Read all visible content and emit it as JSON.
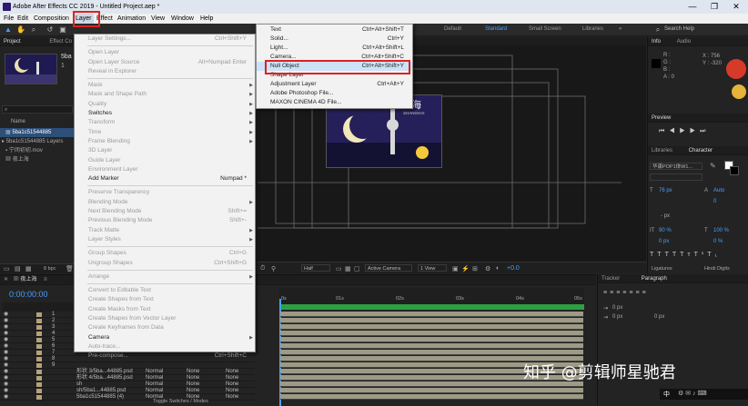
{
  "window": {
    "title": "Adobe After Effects CC 2019 - Untitled Project.aep *",
    "minimize": "—",
    "restore": "❐",
    "close": "✕"
  },
  "menubar": {
    "items": [
      "File",
      "Edit",
      "Composition",
      "Layer",
      "Effect",
      "Animation",
      "View",
      "Window",
      "Help"
    ]
  },
  "toolbar": {
    "workspaces": [
      "Default",
      "Standard",
      "Small Screen",
      "Libraries"
    ],
    "search_placeholder": "Search Help"
  },
  "project": {
    "tab": "Project",
    "effect_tab": "Effect Co",
    "item_name": "5ba",
    "item_detail": "1",
    "name_header": "Name",
    "items": [
      "5ba1c51544885",
      "5ba1c51544885 Layers",
      "宁闭初初.mov",
      "夜上海"
    ],
    "bpc": "8 bpc"
  },
  "layer_menu": {
    "items": [
      {
        "label": "Layer Settings...",
        "shortcut": "Ctrl+Shift+Y",
        "disabled": true
      },
      {
        "sep": true
      },
      {
        "label": "Open Layer",
        "disabled": true
      },
      {
        "label": "Open Layer Source",
        "shortcut": "Alt+Numpad Enter",
        "disabled": true
      },
      {
        "label": "Reveal in Explorer",
        "disabled": true
      },
      {
        "sep": true
      },
      {
        "label": "Mask",
        "arrow": true,
        "disabled": true
      },
      {
        "label": "Mask and Shape Path",
        "arrow": true,
        "disabled": true
      },
      {
        "label": "Quality",
        "arrow": true,
        "disabled": true
      },
      {
        "label": "Switches",
        "arrow": true
      },
      {
        "label": "Transform",
        "arrow": true,
        "disabled": true
      },
      {
        "label": "Time",
        "arrow": true,
        "disabled": true
      },
      {
        "label": "Frame Blending",
        "arrow": true,
        "disabled": true
      },
      {
        "label": "3D Layer",
        "disabled": true
      },
      {
        "label": "Guide Layer",
        "disabled": true
      },
      {
        "label": "Environment Layer",
        "disabled": true
      },
      {
        "label": "Add Marker",
        "shortcut": "Numpad *"
      },
      {
        "sep": true
      },
      {
        "label": "Preserve Transparency",
        "disabled": true
      },
      {
        "label": "Blending Mode",
        "arrow": true,
        "disabled": true
      },
      {
        "label": "Next Blending Mode",
        "shortcut": "Shift+=",
        "disabled": true
      },
      {
        "label": "Previous Blending Mode",
        "shortcut": "Shift+-",
        "disabled": true
      },
      {
        "label": "Track Matte",
        "arrow": true,
        "disabled": true
      },
      {
        "label": "Layer Styles",
        "arrow": true,
        "disabled": true
      },
      {
        "sep": true
      },
      {
        "label": "Group Shapes",
        "shortcut": "Ctrl+G",
        "disabled": true
      },
      {
        "label": "Ungroup Shapes",
        "shortcut": "Ctrl+Shift+G",
        "disabled": true
      },
      {
        "sep": true
      },
      {
        "label": "Arrange",
        "arrow": true,
        "disabled": true
      },
      {
        "sep": true
      },
      {
        "label": "Convert to Editable Text",
        "disabled": true
      },
      {
        "label": "Create Shapes from Text",
        "disabled": true
      },
      {
        "label": "Create Masks from Text",
        "disabled": true
      },
      {
        "label": "Create Shapes from Vector Layer",
        "disabled": true
      },
      {
        "label": "Create Keyframes from Data",
        "disabled": true
      },
      {
        "label": "Camera",
        "arrow": true
      },
      {
        "label": "Auto-trace...",
        "disabled": true
      },
      {
        "label": "Pre-compose...",
        "shortcut": "Ctrl+Shift+C",
        "disabled": true
      }
    ]
  },
  "new_submenu": {
    "items": [
      {
        "label": "Text",
        "shortcut": "Ctrl+Alt+Shift+T"
      },
      {
        "label": "Solid...",
        "shortcut": "Ctrl+Y"
      },
      {
        "label": "Light...",
        "shortcut": "Ctrl+Alt+Shift+L"
      },
      {
        "label": "Camera...",
        "shortcut": "Ctrl+Alt+Shift+C"
      },
      {
        "label": "Null Object",
        "shortcut": "Ctrl+Alt+Shift+Y"
      },
      {
        "label": "Shape Layer"
      },
      {
        "label": "Adjustment Layer",
        "shortcut": "Ctrl+Alt+Y"
      },
      {
        "label": "Adobe Photoshop File..."
      },
      {
        "label": "MAXON CINEMA 4D File..."
      }
    ]
  },
  "viewer": {
    "art_title": "上海",
    "art_subtitle": "SHANGHAI",
    "zoom": "Half",
    "camera": "Active Camera",
    "view": "1 View",
    "exposure": "+0.0"
  },
  "info": {
    "tab": "Info",
    "audio_tab": "Audio",
    "r": "R :",
    "g": "G :",
    "b": "B :",
    "a": "A : 0",
    "x": "X : 756",
    "y": "Y : -320"
  },
  "preview": {
    "tab": "Preview"
  },
  "character": {
    "libraries_tab": "Libraries",
    "tab": "Character",
    "font": "华康POP1体W1...",
    "size": "76 px",
    "leading": "Auto",
    "tracking": "0",
    "stroke": "- px",
    "vscale": "90 %",
    "hscale": "100 %",
    "baseline": "0 px",
    "tsume": "0 %",
    "ligatures": "Ligatures",
    "hindi": "Hindi Digits"
  },
  "timeline": {
    "comp_tab": "夜上海",
    "timecode": "0:00:00:00",
    "ruler": [
      "0s",
      "01s",
      "02s",
      "03s",
      "04s",
      "05s"
    ],
    "toggle": "Toggle Switches / Modes",
    "layers": [
      {
        "num": "1",
        "name": "",
        "mode": "",
        "trk": "",
        "parent": ""
      },
      {
        "num": "2",
        "name": "",
        "mode": "",
        "trk": "",
        "parent": ""
      },
      {
        "num": "3",
        "name": "",
        "mode": "",
        "trk": "",
        "parent": ""
      },
      {
        "num": "4",
        "name": "",
        "mode": "",
        "trk": "",
        "parent": ""
      },
      {
        "num": "5",
        "name": "",
        "mode": "",
        "trk": "",
        "parent": ""
      },
      {
        "num": "6",
        "name": "",
        "mode": "",
        "trk": "",
        "parent": ""
      },
      {
        "num": "7",
        "name": "",
        "mode": "",
        "trk": "",
        "parent": ""
      },
      {
        "num": "8",
        "name": "",
        "mode": "",
        "trk": "",
        "parent": ""
      },
      {
        "num": "9",
        "name": "",
        "mode": "",
        "trk": "",
        "parent": ""
      },
      {
        "num": "",
        "name": "形状 3/5ba...44885.psd",
        "mode": "Normal",
        "trk": "None",
        "parent": "None"
      },
      {
        "num": "",
        "name": "形状 4/5ba...44885.psd",
        "mode": "Normal",
        "trk": "None",
        "parent": "None"
      },
      {
        "num": "",
        "name": "sh",
        "mode": "Normal",
        "trk": "None",
        "parent": "None"
      },
      {
        "num": "",
        "name": "sh/5ba1...44885.psd",
        "mode": "Normal",
        "trk": "None",
        "parent": "None"
      },
      {
        "num": "",
        "name": "5ba1c51544885 (4)",
        "mode": "Normal",
        "trk": "None",
        "parent": "None"
      }
    ]
  },
  "right_bottom": {
    "tracker_tab": "Tracker",
    "paragraph_tab": "Paragraph",
    "indent1": "0 px",
    "indent2": "0 px",
    "space": "0 px"
  },
  "watermark": "知乎 @剪辑师星驰君",
  "taskbar_tray": "中"
}
